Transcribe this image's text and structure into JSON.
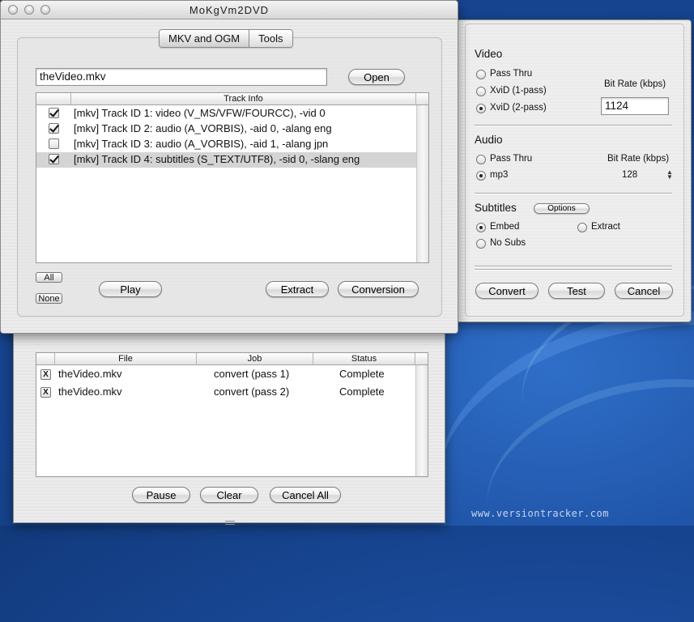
{
  "app": {
    "title": "MoKgVm2DVD"
  },
  "tabs": [
    {
      "label": "MKV and OGM",
      "selected": true
    },
    {
      "label": "Tools",
      "selected": false
    }
  ],
  "file": {
    "value": "theVideo.mkv",
    "open_label": "Open"
  },
  "track_table": {
    "header": "Track Info",
    "rows": [
      {
        "checked": true,
        "text": "[mkv] Track ID 1: video (V_MS/VFW/FOURCC), -vid 0"
      },
      {
        "checked": true,
        "text": "[mkv] Track ID 2: audio (A_VORBIS), -aid 0, -alang eng"
      },
      {
        "checked": false,
        "text": "[mkv] Track ID 3: audio (A_VORBIS), -aid 1, -alang jpn"
      },
      {
        "checked": true,
        "text": "[mkv] Track ID 4: subtitles (S_TEXT/UTF8), -sid 0, -slang eng",
        "selected": true
      }
    ]
  },
  "track_buttons": {
    "all": "All",
    "none": "None",
    "play": "Play",
    "extract": "Extract",
    "conversion": "Conversion"
  },
  "settings": {
    "video": {
      "heading": "Video",
      "options": [
        {
          "label": "Pass Thru",
          "selected": false
        },
        {
          "label": "XviD (1-pass)",
          "selected": false
        },
        {
          "label": "XviD (2-pass)",
          "selected": true
        }
      ],
      "bitrate_label": "Bit Rate (kbps)",
      "bitrate_value": "1124"
    },
    "audio": {
      "heading": "Audio",
      "options": [
        {
          "label": "Pass Thru",
          "selected": false
        },
        {
          "label": "mp3",
          "selected": true
        }
      ],
      "bitrate_label": "Bit Rate (kbps)",
      "bitrate_value": "128"
    },
    "subtitles": {
      "heading": "Subtitles",
      "options_button": "Options",
      "options": [
        {
          "label": "Embed",
          "selected": true
        },
        {
          "label": "Extract",
          "selected": false
        },
        {
          "label": "No Subs",
          "selected": false
        }
      ]
    },
    "buttons": {
      "convert": "Convert",
      "test": "Test",
      "cancel": "Cancel"
    }
  },
  "job_queue": {
    "columns": [
      "File",
      "Job",
      "Status"
    ],
    "rows": [
      {
        "mark": "X",
        "file": "theVideo.mkv",
        "job": "convert (pass 1)",
        "status": "Complete"
      },
      {
        "mark": "X",
        "file": "theVideo.mkv",
        "job": "convert (pass 2)",
        "status": "Complete"
      }
    ],
    "buttons": {
      "pause": "Pause",
      "clear": "Clear",
      "cancel_all": "Cancel All"
    }
  },
  "watermark": "www.versiontracker.com",
  "colors": {
    "desktop": "#1b4d9f",
    "selected_row": "#d4d4d4",
    "window_bg": "#ececec"
  }
}
